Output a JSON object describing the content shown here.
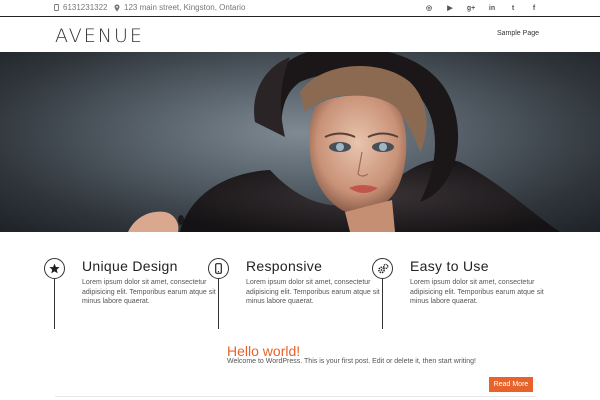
{
  "topbar": {
    "phone": "6131231322",
    "address": "123 main street, Kingston, Ontario",
    "socials": [
      "dribbble-icon",
      "youtube-icon",
      "google-plus-icon",
      "linkedin-icon",
      "twitter-icon",
      "facebook-icon"
    ],
    "social_glyphs": [
      "◎",
      "▶",
      "g+",
      "in",
      "t",
      "f"
    ]
  },
  "header": {
    "logo": "AVENUE",
    "menu": [
      "Sample Page"
    ]
  },
  "features": [
    {
      "title": "Unique Design",
      "icon": "star-icon",
      "text": "Lorem ipsum dolor sit amet, consectetur adipisicing elit. Temporibus earum atque sit minus labore quaerat."
    },
    {
      "title": "Responsive",
      "icon": "mobile-icon",
      "text": "Lorem ipsum dolor sit amet, consectetur adipisicing elit. Temporibus earum atque sit minus labore quaerat."
    },
    {
      "title": "Easy to Use",
      "icon": "cogs-icon",
      "text": "Lorem ipsum dolor sit amet, consectetur adipisicing elit. Temporibus earum atque sit minus labore quaerat."
    }
  ],
  "post": {
    "title": "Hello world!",
    "excerpt": "Welcome to WordPress. This is your first post. Edit or delete it, then start writing!",
    "read_more": "Read More"
  },
  "colors": {
    "accent": "#e8632b",
    "topbar_border": "#222222"
  }
}
